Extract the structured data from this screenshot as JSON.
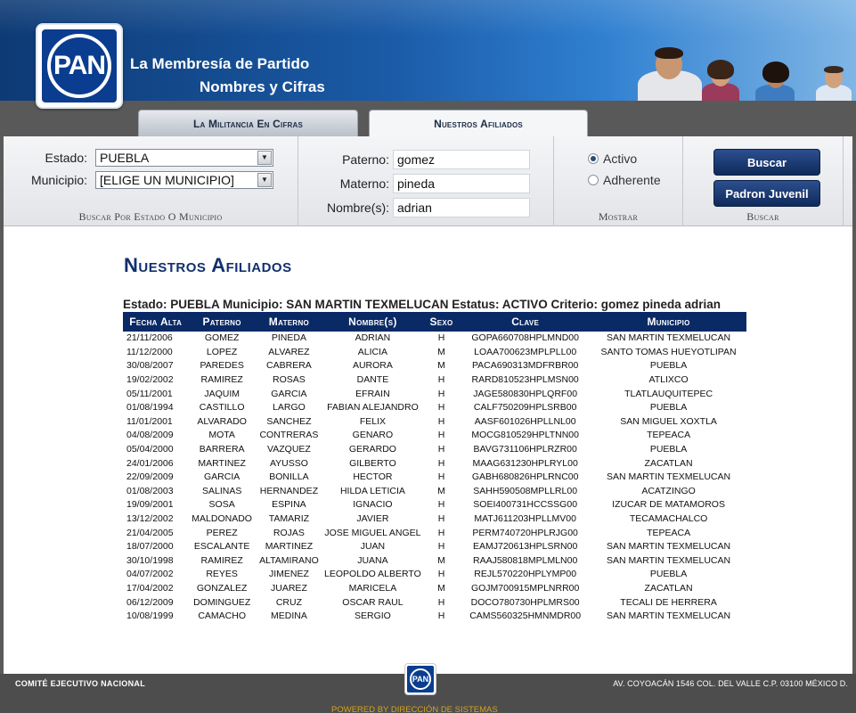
{
  "header": {
    "logo_text": "PAN",
    "title": "La Membresía de Partido",
    "subtitle": "Nombres y Cifras"
  },
  "tabs": [
    {
      "label": "La Militancia En Cifras",
      "active": false
    },
    {
      "label": "Nuestros Afiliados",
      "active": true
    }
  ],
  "filters": {
    "estado_label": "Estado:",
    "estado_value": "PUEBLA",
    "municipio_label": "Municipio:",
    "municipio_value": "[ELIGE UN MUNICIPIO]",
    "section1_caption": "Buscar Por Estado O Municipio",
    "paterno_label": "Paterno:",
    "paterno_value": "gomez",
    "materno_label": "Materno:",
    "materno_value": "pineda",
    "nombres_label": "Nombre(s):",
    "nombres_value": "adrian",
    "activo_label": "Activo",
    "adherente_label": "Adherente",
    "mostrar_caption": "Mostrar",
    "buscar_button": "Buscar",
    "padron_button": "Padron Juvenil",
    "buscar_caption": "Buscar"
  },
  "main": {
    "page_title": "Nuestros Afiliados",
    "summary": "Estado: PUEBLA Municipio: SAN MARTIN TEXMELUCAN Estatus: ACTIVO Criterio: gomez pineda adrian",
    "columns": [
      "Fecha Alta",
      "Paterno",
      "Materno",
      "Nombre(s)",
      "Sexo",
      "Clave",
      "Municipio"
    ],
    "rows": [
      [
        "21/11/2006",
        "GOMEZ",
        "PINEDA",
        "ADRIAN",
        "H",
        "GOPA660708HPLMND00",
        "SAN MARTIN TEXMELUCAN"
      ],
      [
        "11/12/2000",
        "LOPEZ",
        "ALVAREZ",
        "ALICIA",
        "M",
        "LOAA700623MPLPLL00",
        "SANTO TOMAS HUEYOTLIPAN"
      ],
      [
        "30/08/2007",
        "PAREDES",
        "CABRERA",
        "AURORA",
        "M",
        "PACA690313MDFRBR00",
        "PUEBLA"
      ],
      [
        "19/02/2002",
        "RAMIREZ",
        "ROSAS",
        "DANTE",
        "H",
        "RARD810523HPLMSN00",
        "ATLIXCO"
      ],
      [
        "05/11/2001",
        "JAQUIM",
        "GARCIA",
        "EFRAIN",
        "H",
        "JAGE580830HPLQRF00",
        "TLATLAUQUITEPEC"
      ],
      [
        "01/08/1994",
        "CASTILLO",
        "LARGO",
        "FABIAN ALEJANDRO",
        "H",
        "CALF750209HPLSRB00",
        "PUEBLA"
      ],
      [
        "11/01/2001",
        "ALVARADO",
        "SANCHEZ",
        "FELIX",
        "H",
        "AASF601026HPLLNL00",
        "SAN MIGUEL XOXTLA"
      ],
      [
        "04/08/2009",
        "MOTA",
        "CONTRERAS",
        "GENARO",
        "H",
        "MOCG810529HPLTNN00",
        "TEPEACA"
      ],
      [
        "05/04/2000",
        "BARRERA",
        "VAZQUEZ",
        "GERARDO",
        "H",
        "BAVG731106HPLRZR00",
        "PUEBLA"
      ],
      [
        "24/01/2006",
        "MARTINEZ",
        "AYUSSO",
        "GILBERTO",
        "H",
        "MAAG631230HPLRYL00",
        "ZACATLAN"
      ],
      [
        "22/09/2009",
        "GARCIA",
        "BONILLA",
        "HECTOR",
        "H",
        "GABH680826HPLRNC00",
        "SAN MARTIN TEXMELUCAN"
      ],
      [
        "01/08/2003",
        "SALINAS",
        "HERNANDEZ",
        "HILDA LETICIA",
        "M",
        "SAHH590508MPLLRL00",
        "ACATZINGO"
      ],
      [
        "19/09/2001",
        "SOSA",
        "ESPINA",
        "IGNACIO",
        "H",
        "SOEI400731HCCSSG00",
        "IZUCAR DE MATAMOROS"
      ],
      [
        "13/12/2002",
        "MALDONADO",
        "TAMARIZ",
        "JAVIER",
        "H",
        "MATJ611203HPLLMV00",
        "TECAMACHALCO"
      ],
      [
        "21/04/2005",
        "PEREZ",
        "ROJAS",
        "JOSE MIGUEL ANGEL",
        "H",
        "PERM740720HPLRJG00",
        "TEPEACA"
      ],
      [
        "18/07/2000",
        "ESCALANTE",
        "MARTINEZ",
        "JUAN",
        "H",
        "EAMJ720613HPLSRN00",
        "SAN MARTIN TEXMELUCAN"
      ],
      [
        "30/10/1998",
        "RAMIREZ",
        "ALTAMIRANO",
        "JUANA",
        "M",
        "RAAJ580818MPLMLN00",
        "SAN MARTIN TEXMELUCAN"
      ],
      [
        "04/07/2002",
        "REYES",
        "JIMENEZ",
        "LEOPOLDO ALBERTO",
        "H",
        "REJL570220HPLYMP00",
        "PUEBLA"
      ],
      [
        "17/04/2002",
        "GONZALEZ",
        "JUAREZ",
        "MARICELA",
        "M",
        "GOJM700915MPLNRR00",
        "ZACATLAN"
      ],
      [
        "06/12/2009",
        "DOMINGUEZ",
        "CRUZ",
        "OSCAR RAUL",
        "H",
        "DOCO780730HPLMRS00",
        "TECALI DE HERRERA"
      ],
      [
        "10/08/1999",
        "CAMACHO",
        "MEDINA",
        "SERGIO",
        "H",
        "CAMS560325HMNMDR00",
        "SAN MARTIN TEXMELUCAN"
      ]
    ]
  },
  "footer": {
    "left": "COMITÉ EJECUTIVO NACIONAL",
    "logo_text": "PAN",
    "right": "AV. COYOACÁN 1546 COL. DEL VALLE C.P. 03100 MÉXICO D.",
    "powered": "POWERED BY DIRECCIÓN DE SISTEMAS"
  },
  "colors": {
    "brand_blue": "#0a2a66",
    "title_blue": "#10306e",
    "footer_gold": "#d8a21c"
  }
}
